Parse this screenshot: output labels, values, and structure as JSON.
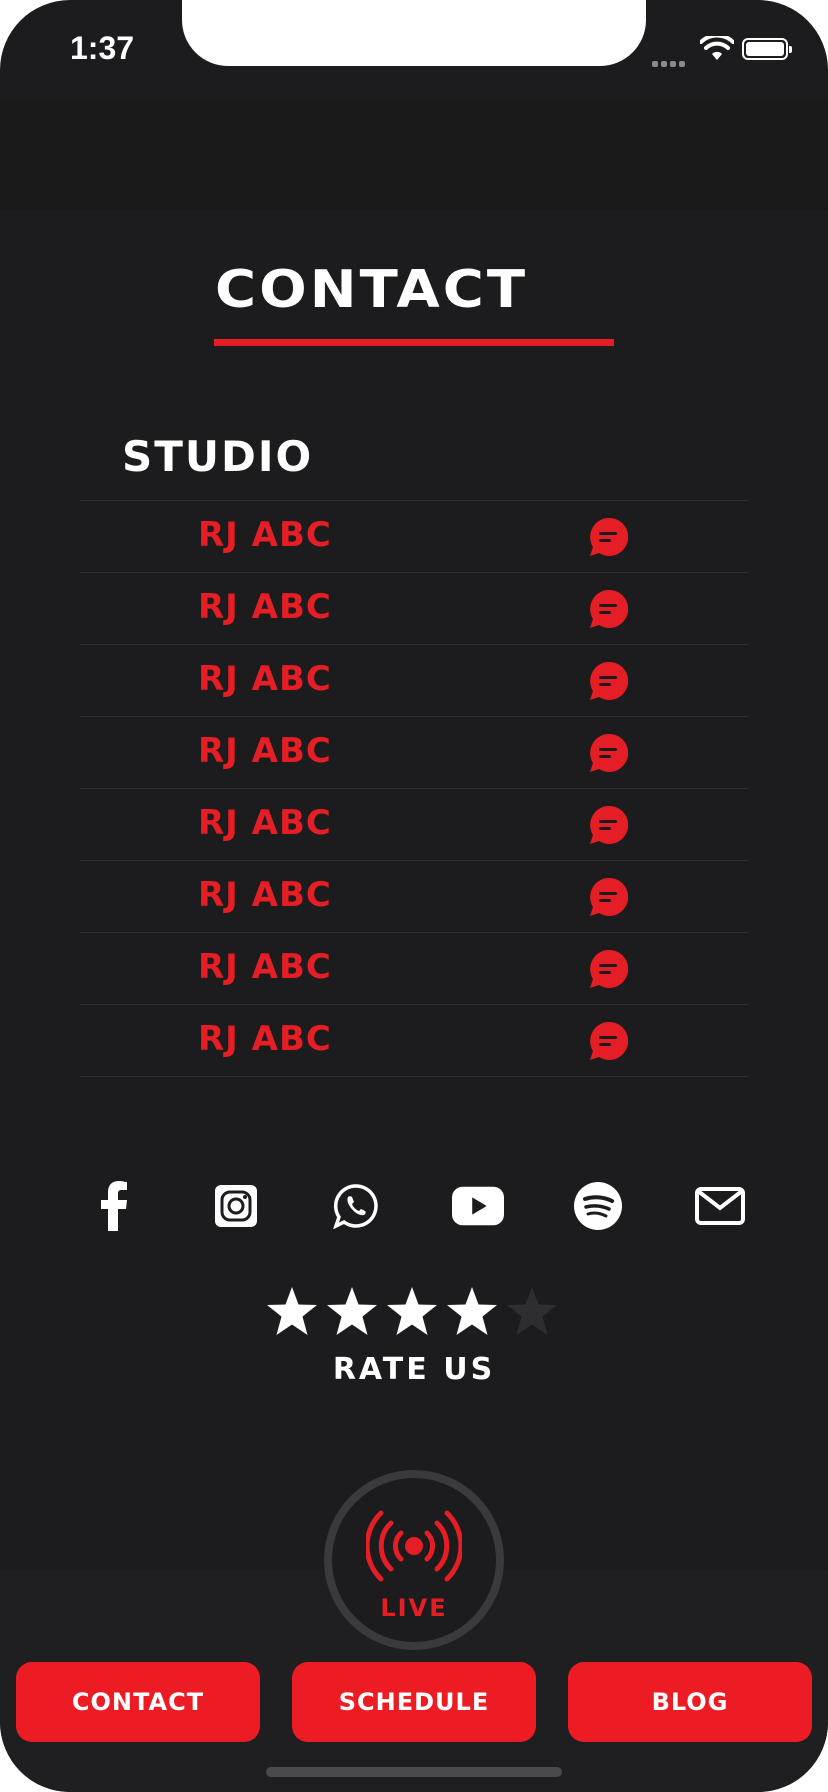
{
  "status_bar": {
    "time": "1:37"
  },
  "page": {
    "title": "CONTACT"
  },
  "studio": {
    "heading": "STUDIO",
    "contacts": [
      {
        "name": "RJ ABC"
      },
      {
        "name": "RJ ABC"
      },
      {
        "name": "RJ ABC"
      },
      {
        "name": "RJ ABC"
      },
      {
        "name": "RJ ABC"
      },
      {
        "name": "RJ ABC"
      },
      {
        "name": "RJ ABC"
      },
      {
        "name": "RJ ABC"
      }
    ]
  },
  "socials": [
    "facebook-icon",
    "instagram-icon",
    "whatsapp-icon",
    "youtube-icon",
    "spotify-icon",
    "mail-icon"
  ],
  "rating": {
    "label": "RATE US",
    "value": 4,
    "max": 5
  },
  "live": {
    "label": "LIVE"
  },
  "nav": {
    "contact": "CONTACT",
    "schedule": "SCHEDULE",
    "blog": "BLOG"
  },
  "colors": {
    "accent": "#ed1c24",
    "background": "#1c1c1e",
    "text": "#ffffff",
    "inactive_star": "#2e2e30"
  }
}
